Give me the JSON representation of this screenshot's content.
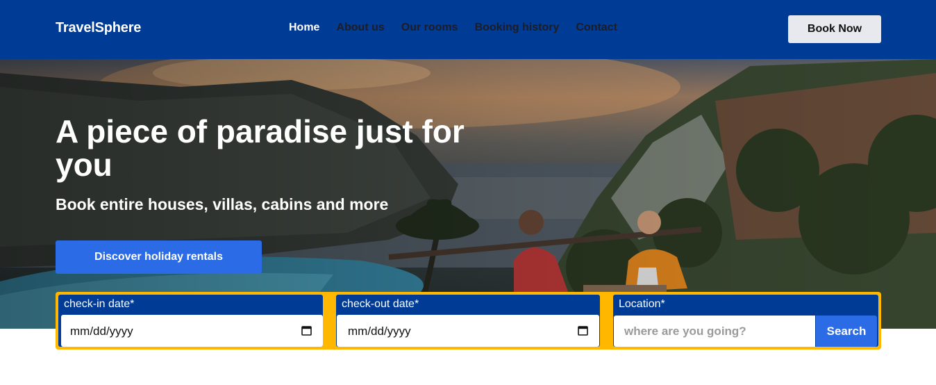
{
  "nav": {
    "brand": "TravelSphere",
    "links": [
      "Home",
      "About us",
      "Our rooms",
      "Booking history",
      "Contact"
    ],
    "active_link": "Home",
    "cta_label": "Book Now"
  },
  "hero": {
    "title": "A piece of paradise just for you",
    "subtitle": "Book entire houses, villas, cabins and more",
    "cta_label": "Discover holiday rentals"
  },
  "search": {
    "checkin_label": "check-in date*",
    "checkin_value": "mm/dd/yyyy",
    "checkout_label": "check-out date*",
    "checkout_value": "mm/dd/yyyy",
    "location_label": "Location*",
    "location_placeholder": "where are you going?",
    "search_label": "Search"
  },
  "icons": {
    "date_picker": "calendar-icon"
  },
  "colors": {
    "nav_bg": "#003b95",
    "accent_blue": "#2b6be6",
    "search_border": "#ffb700",
    "book_btn_bg": "#e8e9ee"
  }
}
